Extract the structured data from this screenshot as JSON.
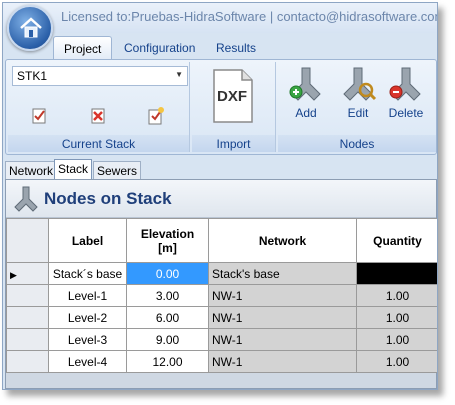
{
  "titlebar": {
    "title": "Licensed to:Pruebas-HidraSoftware  |  contacto@hidrasoftware.com"
  },
  "ribbon_tabs": [
    {
      "label": "Project",
      "active": true
    },
    {
      "label": "Configuration",
      "active": false
    },
    {
      "label": "Results",
      "active": false
    }
  ],
  "ribbon": {
    "current_stack": {
      "combo_value": "STK1",
      "group_label": "Current Stack"
    },
    "import": {
      "group_label": "Import",
      "dxf_label": "DXF"
    },
    "nodes": {
      "group_label": "Nodes",
      "add_label": "Add",
      "edit_label": "Edit",
      "delete_label": "Delete"
    }
  },
  "doc_tabs": [
    {
      "label": "Network",
      "active": false
    },
    {
      "label": "Stack",
      "active": true
    },
    {
      "label": "Sewers",
      "active": false
    }
  ],
  "panel": {
    "title": "Nodes on Stack"
  },
  "grid": {
    "columns": [
      "Label",
      "Elevation [m]",
      "Network",
      "Quantity"
    ],
    "rows": [
      {
        "label": "Stack´s base",
        "elevation": "0.00",
        "network": "Stack's base",
        "quantity": ""
      },
      {
        "label": "Level-1",
        "elevation": "3.00",
        "network": "NW-1",
        "quantity": "1.00"
      },
      {
        "label": "Level-2",
        "elevation": "6.00",
        "network": "NW-1",
        "quantity": "1.00"
      },
      {
        "label": "Level-3",
        "elevation": "9.00",
        "network": "NW-1",
        "quantity": "1.00"
      },
      {
        "label": "Level-4",
        "elevation": "12.00",
        "network": "NW-1",
        "quantity": "1.00"
      }
    ],
    "current_row_marker": "▶"
  },
  "colors": {
    "accent": "#15428b",
    "selected_cell": "#3399ff",
    "panel_title": "#1f3f7a"
  }
}
